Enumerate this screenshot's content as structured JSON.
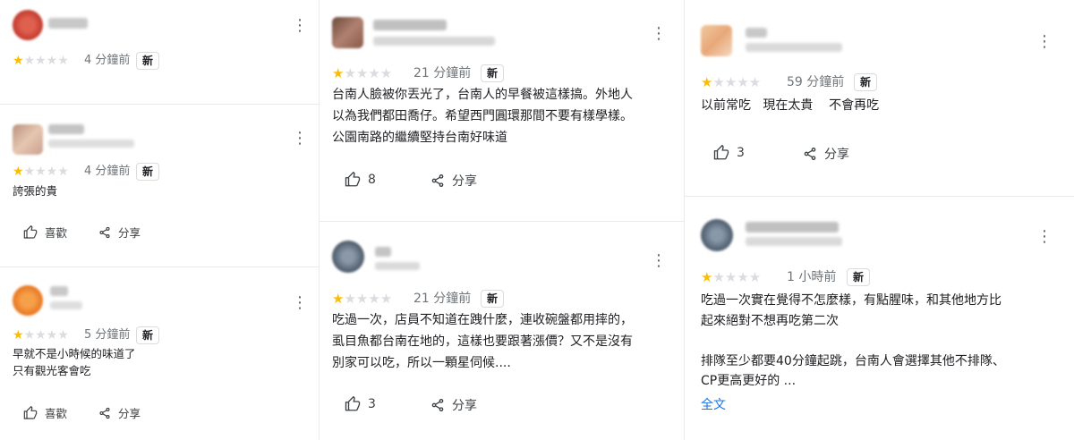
{
  "common": {
    "badge": "新",
    "like_label": "喜歡",
    "share_label": "分享"
  },
  "colors": {
    "star": "#fbbc04",
    "star_empty": "#dadce0",
    "link": "#1a73e8"
  },
  "col1": [
    {
      "rating": 1,
      "time": "4 分鐘前",
      "text": ""
    },
    {
      "rating": 1,
      "time": "4 分鐘前",
      "text": "誇張的貴"
    },
    {
      "rating": 1,
      "time": "5 分鐘前",
      "text": "早就不是小時候的味道了\n只有觀光客會吃"
    }
  ],
  "col2": [
    {
      "rating": 1,
      "time": "21 分鐘前",
      "text": "台南人臉被你丟光了，台南人的早餐被這樣搞。外地人\n以為我們都田喬仔。希望西門圓環那間不要有樣學樣。\n公園南路的繼續堅持台南好味道",
      "likes": "8"
    },
    {
      "rating": 1,
      "time": "21 分鐘前",
      "text": "吃過一次，店員不知道在跩什麼，連收碗盤都用摔的，\n虱目魚都台南在地的，這樣也要跟著漲價？又不是沒有\n別家可以吃，所以一顆星伺候....",
      "likes": "3"
    }
  ],
  "col3": [
    {
      "rating": 1,
      "time": "59 分鐘前",
      "text": "以前常吃   現在太貴    不會再吃",
      "likes": "3"
    },
    {
      "rating": 1,
      "time": "1 小時前",
      "text": "吃過一次實在覺得不怎麼樣，有點腥味，和其他地方比\n起來絕對不想再吃第二次\n\n排隊至少都要40分鐘起跳，台南人會選擇其他不排隊、\nCP更高更好的 ...",
      "more_label": "全文"
    }
  ]
}
